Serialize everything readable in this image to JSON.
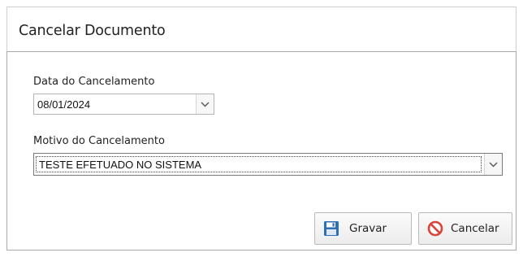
{
  "dialog": {
    "title": "Cancelar Documento"
  },
  "form": {
    "date": {
      "label": "Data do Cancelamento",
      "value": "08/01/2024"
    },
    "reason": {
      "label": "Motivo do Cancelamento",
      "value": "TESTE EFETUADO NO SISTEMA"
    }
  },
  "buttons": {
    "save_label": "Gravar",
    "cancel_label": "Cancelar"
  },
  "icons": {
    "save": "floppy-disk-icon",
    "cancel": "prohibited-icon",
    "dropdown": "chevron-down-icon"
  },
  "colors": {
    "save_icon_blue": "#2f6fb5",
    "cancel_icon_red": "#d9443a"
  }
}
